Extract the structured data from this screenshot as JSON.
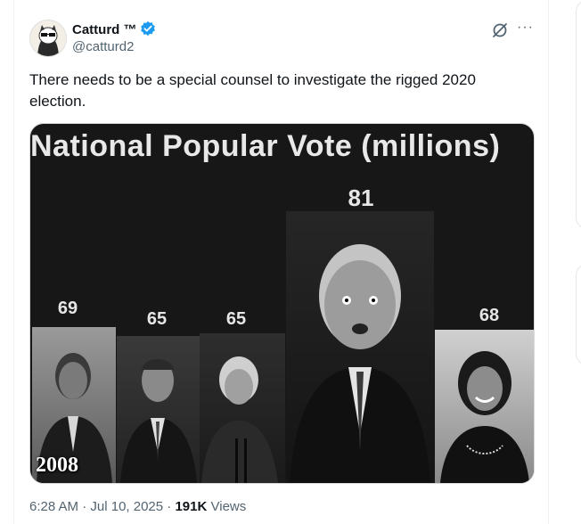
{
  "author": {
    "name": "Catturd ™",
    "handle": "@catturd2",
    "verified_color": "#1d9bf0"
  },
  "icons": {
    "grok": "grok-slash-icon",
    "more": "more-horizontal-icon"
  },
  "tweet": {
    "text": "There needs to be a special counsel to investigate the rigged 2020 election."
  },
  "media": {
    "title": "National Popular Vote (millions)",
    "year_label": "2008"
  },
  "chart_data": {
    "type": "bar",
    "title": "National Popular Vote (millions)",
    "values": [
      69,
      65,
      65,
      81,
      68
    ]
  },
  "footer": {
    "time": "6:28 AM",
    "date": "Jul 10, 2025",
    "views_count": "191K",
    "views_label": "Views"
  }
}
